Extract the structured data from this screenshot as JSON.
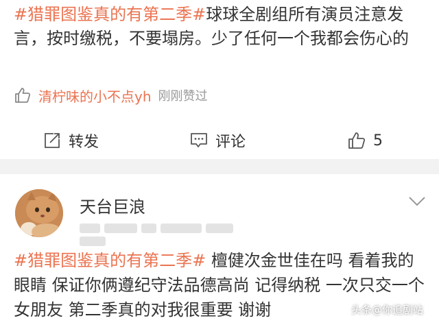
{
  "post": {
    "hashtag": "#猎罪图鉴真的有第二季#",
    "body": "球球全剧组所有演员注意发言，按时缴税，不要塌房。少了任何一个我都会伤心的",
    "liked_by": "清柠味的小不点yh",
    "liked_status": "刚刚赞过"
  },
  "actions": {
    "forward_label": "转发",
    "comment_label": "评论",
    "like_count": "5"
  },
  "comment": {
    "username": "天台巨浪",
    "hashtag": "#猎罪图鉴真的有第二季#",
    "body": " 檀健次金世佳在吗 看着我的眼睛 保证你俩遵纪守法品德高尚 记得纳税 一次只交一个女朋友 第二季真的对我很重要 谢谢"
  },
  "watermark": {
    "text": "头条@你追剧站"
  },
  "colors": {
    "accent": "#eb7350",
    "text": "#333333",
    "muted": "#999999",
    "divider": "#f2f2f2"
  },
  "icons": {
    "like": "thumb-up-icon",
    "forward": "share-arrow-icon",
    "comment": "comment-bubble-icon",
    "expand": "chevron-down-icon"
  }
}
